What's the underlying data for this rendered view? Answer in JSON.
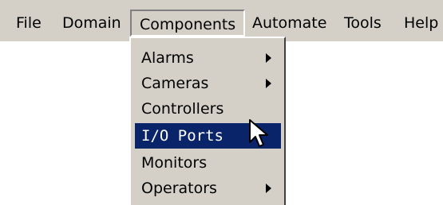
{
  "menubar": {
    "items": [
      {
        "label": "File"
      },
      {
        "label": "Domain"
      },
      {
        "label": "Components",
        "state": "open"
      },
      {
        "label": "Automate"
      },
      {
        "label": "Tools"
      },
      {
        "label": "Help"
      }
    ]
  },
  "dropdown": {
    "items": [
      {
        "label": "Alarms",
        "submenu": true
      },
      {
        "label": "Cameras",
        "submenu": true
      },
      {
        "label": "Controllers",
        "submenu": false
      },
      {
        "label": "I/O Ports",
        "submenu": false,
        "highlighted": true
      },
      {
        "label": "Monitors",
        "submenu": false
      },
      {
        "label": "Operators",
        "submenu": true
      }
    ]
  },
  "colors": {
    "menu_background": "#d4d0c8",
    "highlight_background": "#0a246a",
    "highlight_text": "#ffffff"
  },
  "cursor": {
    "icon": "arrow-pointer-icon"
  }
}
